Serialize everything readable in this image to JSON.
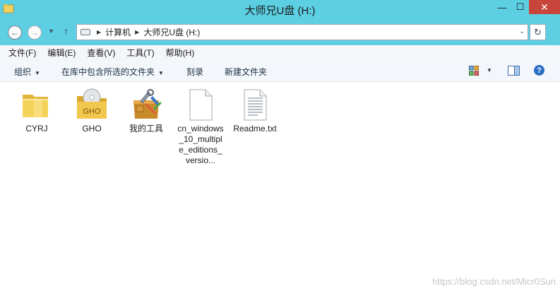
{
  "window": {
    "title": "大师兄U盘 (H:)",
    "buttons": {
      "minimize": "—",
      "maximize": "☐",
      "close": "✕"
    }
  },
  "nav": {
    "back_glyph": "←",
    "forward_glyph": "→",
    "recent_glyph": "▼",
    "up_glyph": "↑",
    "breadcrumbs": [
      "计算机",
      "大师兄U盘 (H:)"
    ],
    "crumb_sep": "▶",
    "address_dropdown_glyph": "⌄",
    "refresh_glyph": "↻"
  },
  "menu": {
    "items": [
      "文件(F)",
      "编辑(E)",
      "查看(V)",
      "工具(T)",
      "帮助(H)"
    ]
  },
  "toolbar": {
    "organize": "组织",
    "include_in_library": "在库中包含所选的文件夹",
    "burn": "刻录",
    "new_folder": "新建文件夹",
    "dropdown_glyph": "▼",
    "help_glyph": "?"
  },
  "files": [
    {
      "name": "CYRJ",
      "type": "folder",
      "icon": "folder-icon"
    },
    {
      "name": "GHO",
      "type": "folder",
      "icon": "gho-folder-icon",
      "badge": "GHO"
    },
    {
      "name": "我的工具",
      "type": "folder",
      "icon": "toolbox-folder-icon"
    },
    {
      "name": "cn_windows_10_multiple_editions_versio...",
      "type": "file",
      "icon": "blank-file-icon"
    },
    {
      "name": "Readme.txt",
      "type": "file",
      "icon": "text-file-icon"
    }
  ],
  "watermark": "https://blog.csdn.net/Micr0Sun",
  "colors": {
    "titlebar": "#5ccfe2",
    "close_button": "#c7453b",
    "folder": "#f5d35a"
  }
}
